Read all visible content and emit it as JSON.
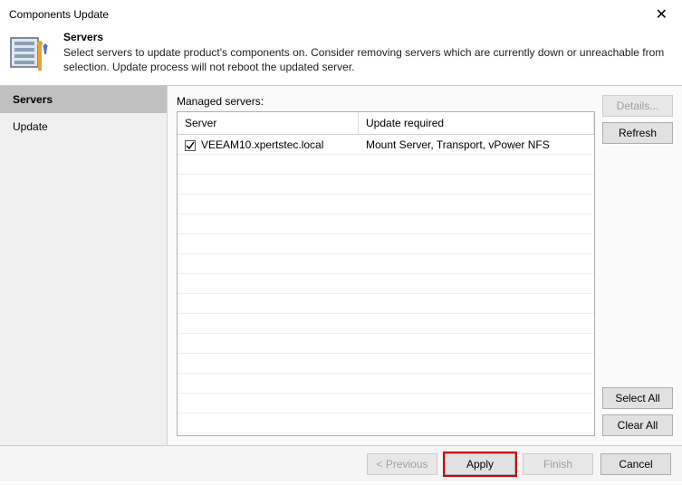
{
  "window": {
    "title": "Components Update"
  },
  "header": {
    "title": "Servers",
    "description": "Select servers to update product's components on. Consider removing servers which are currently down or unreachable from selection. Update process will not reboot the updated server."
  },
  "sidebar": {
    "items": [
      {
        "label": "Servers",
        "active": true
      },
      {
        "label": "Update",
        "active": false
      }
    ]
  },
  "main": {
    "label": "Managed servers:",
    "columns": {
      "server": "Server",
      "update": "Update required"
    },
    "rows": [
      {
        "checked": true,
        "server": "VEEAM10.xpertstec.local",
        "update": "Mount Server, Transport, vPower NFS"
      }
    ]
  },
  "buttons": {
    "details": "Details...",
    "refresh": "Refresh",
    "select_all": "Select All",
    "clear_all": "Clear All",
    "previous": "< Previous",
    "apply": "Apply",
    "finish": "Finish",
    "cancel": "Cancel"
  }
}
